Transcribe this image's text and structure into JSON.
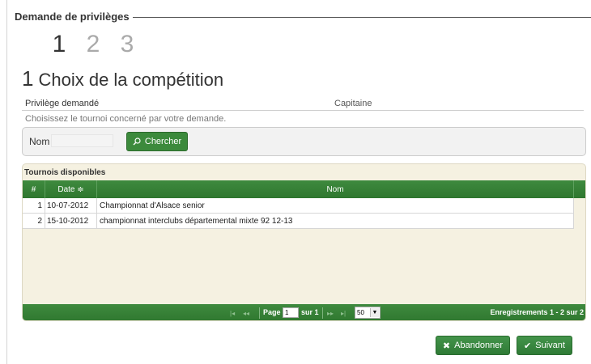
{
  "fieldset": {
    "legend": "Demande de privilèges"
  },
  "steps": [
    "1",
    "2",
    "3"
  ],
  "page_title": {
    "number": "1",
    "text": "Choix de la compétition"
  },
  "info": {
    "label": "Privilège demandé",
    "value": "Capitaine"
  },
  "hint": "Choisissez le tournoi concerné par votre demande.",
  "search": {
    "label": "Nom",
    "value": "",
    "button_label": "Chercher",
    "icon": "search-icon"
  },
  "grid": {
    "caption": "Tournois disponibles",
    "columns": {
      "num": "#",
      "date": "Date",
      "nom": "Nom"
    },
    "sort_icon": "≑",
    "rows": [
      {
        "num": "1",
        "date": "10-07-2012",
        "nom": "Championnat d'Alsace senior"
      },
      {
        "num": "2",
        "date": "15-10-2012",
        "nom": "championnat interclubs départemental mixte 92 12-13"
      }
    ]
  },
  "pager": {
    "first": "|◂",
    "prev": "◂◂",
    "page_label": "Page",
    "page_value": "1",
    "of_label": "sur 1",
    "next": "▸▸",
    "last": "▸|",
    "page_size": "50",
    "records": "Enregistrements 1 - 2 sur 2"
  },
  "buttons": {
    "cancel": "Abandonner",
    "next": "Suivant"
  },
  "colors": {
    "accent": "#3c8a3c",
    "grid_bg": "#f5f1e1"
  }
}
